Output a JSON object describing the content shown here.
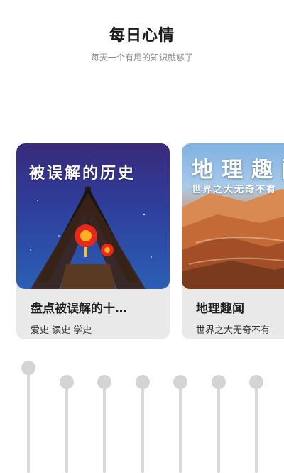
{
  "header": {
    "title": "每日心情",
    "subtitle": "每天一个有用的知识就够了"
  },
  "cards": [
    {
      "cover_title": "被误解的历史",
      "name": "盘点被误解的十…",
      "tags": "爱史 读史 学史"
    },
    {
      "cover_title": "地理趣闻",
      "cover_subtitle": "世界之大无奇不有",
      "name": "地理趣闻",
      "tags": "世界之大无奇不有"
    }
  ],
  "sliders": [
    {
      "level": 1.0
    },
    {
      "level": 0.9
    },
    {
      "level": 0.9
    },
    {
      "level": 0.9
    },
    {
      "level": 0.9
    },
    {
      "level": 0.9
    },
    {
      "level": 0.9
    }
  ],
  "colors": {
    "card_background": "#e9e9e9",
    "slider_color": "#d9d9d9"
  }
}
